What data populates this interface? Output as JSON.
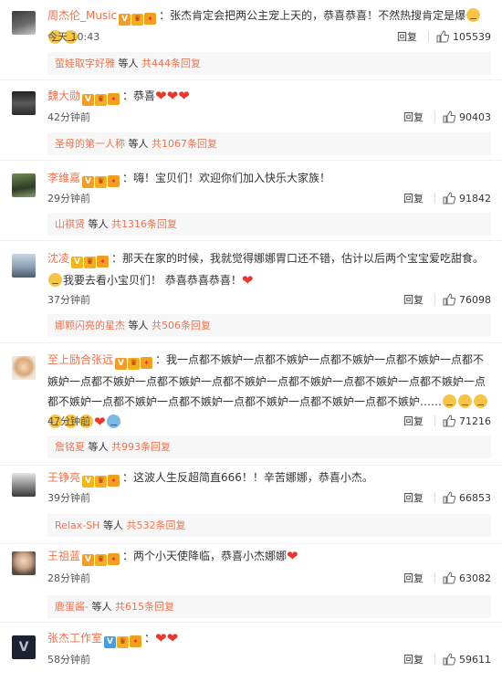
{
  "comments": [
    {
      "username": "周杰伦_Music",
      "text": "：张杰肯定会把两公主宠上天的，恭喜恭喜！不然热搜肯定是爆",
      "time": "今天 10:43",
      "reply_label": "回复",
      "likes": "105539",
      "replies_user": "萤娃取字好雅",
      "replies_text": " 等人 ",
      "replies_count": "共444条回复"
    },
    {
      "username": "魏大勋",
      "text": "：恭喜",
      "time": "42分钟前",
      "reply_label": "回复",
      "likes": "90403",
      "replies_user": "圣母的第一人称",
      "replies_text": " 等人 ",
      "replies_count": "共1067条回复"
    },
    {
      "username": "李维嘉",
      "text": "：嗨！宝贝们！欢迎你们加入快乐大家族！",
      "time": "29分钟前",
      "reply_label": "回复",
      "likes": "91842",
      "replies_user": "山祺贤",
      "replies_text": " 等人 ",
      "replies_count": "共1316条回复"
    },
    {
      "username": "沈凌",
      "text": "：那天在家的时候，我就觉得娜娜胃口还不错，估计以后两个宝宝爱吃甜食。",
      "text2": "我要去看小宝贝们！ 恭喜恭喜恭喜！",
      "time": "37分钟前",
      "reply_label": "回复",
      "likes": "76098",
      "replies_user": "娜颗闪亮的星杰",
      "replies_text": " 等人 ",
      "replies_count": "共506条回复"
    },
    {
      "username": "至上励合张远",
      "text": "：我一点都不嫉妒一点都不嫉妒一点都不嫉妒一点都不嫉妒一点都不嫉妒一点都不嫉妒一点都不嫉妒一点都不嫉妒一点都不嫉妒一点都不嫉妒一点都不嫉妒一点都不嫉妒一点都不嫉妒一点都不嫉妒一点都不嫉妒一点都不嫉妒一点都不嫉妒……",
      "time": "47分钟前",
      "reply_label": "回复",
      "likes": "71216",
      "replies_user": "詹铭夏",
      "replies_text": " 等人 ",
      "replies_count": "共993条回复"
    },
    {
      "username": "王铮亮",
      "text": "：这波人生反超简直666！！辛苦娜娜，恭喜小杰。",
      "time": "39分钟前",
      "reply_label": "回复",
      "likes": "66853",
      "replies_user": "Relax-SH",
      "replies_text": " 等人 ",
      "replies_count": "共532条回复"
    },
    {
      "username": "王祖蓝",
      "text": "：两个小天使降临，恭喜小杰娜娜",
      "time": "28分钟前",
      "reply_label": "回复",
      "likes": "63082",
      "replies_user": "鹿蛋酱-",
      "replies_text": " 等人 ",
      "replies_count": "共615条回复"
    },
    {
      "username": "张杰工作室",
      "text": "：",
      "time": "58分钟前",
      "reply_label": "回复",
      "likes": "59611"
    }
  ],
  "icons": {
    "like": "thumbs-up-icon",
    "heart": "heart-icon",
    "verified": "verified-v-icon",
    "member": "member-crown-icon",
    "gift": "gift-icon"
  },
  "colors": {
    "username": "#eb7350",
    "heart": "#e8382c",
    "verified_orange": "#f09d2b",
    "verified_blue": "#4b9be1"
  }
}
